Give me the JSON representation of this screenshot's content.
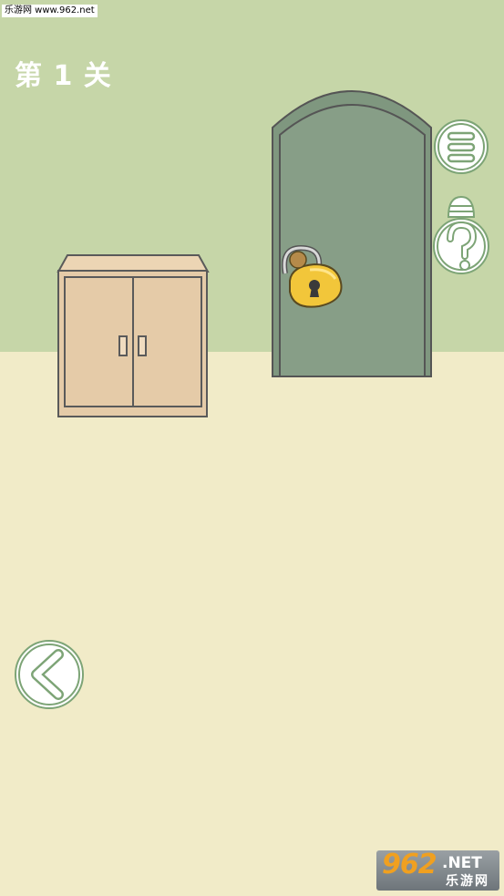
{
  "watermark": {
    "text": "乐游网 www.962.net"
  },
  "level": {
    "title": "第 1 关"
  },
  "hint": {
    "count": ""
  },
  "logo": {
    "number": "962",
    "domain": ".NET",
    "name": "乐游网"
  },
  "icons": {
    "menu": "menu-icon",
    "hint": "question-mark-icon",
    "back": "chevron-left-icon",
    "padlock": "padlock-icon"
  },
  "colors": {
    "wall": "#c6d6a8",
    "floor": "#f1ebc8",
    "door": "#879e87",
    "cabinet": "#e5cba8",
    "padlock": "#f2c63a",
    "button_outline": "#7da476"
  }
}
